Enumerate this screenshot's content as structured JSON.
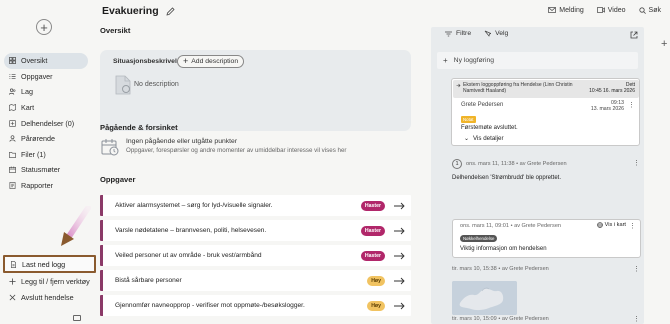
{
  "sidebar": {
    "new_label": "+",
    "items": [
      {
        "label": "Oversikt",
        "icon": "grid-icon"
      },
      {
        "label": "Oppgaver",
        "icon": "checklist-icon"
      },
      {
        "label": "Lag",
        "icon": "people-icon"
      },
      {
        "label": "Kart",
        "icon": "map-icon"
      },
      {
        "label": "Delhendelser (0)",
        "icon": "subevent-icon"
      },
      {
        "label": "Pårørende",
        "icon": "contacts-icon"
      },
      {
        "label": "Filer (1)",
        "icon": "folder-icon"
      },
      {
        "label": "Statusmøter",
        "icon": "calendar-icon"
      },
      {
        "label": "Rapporter",
        "icon": "report-icon"
      }
    ],
    "bottom": {
      "download_log": "Last ned logg",
      "add_remove_tools": "Legg til / fjern verktøy",
      "end_event": "Avslutt hendelse"
    }
  },
  "header": {
    "title": "Evakuering",
    "message": "Melding",
    "video": "Video",
    "search": "Søk"
  },
  "overview": {
    "title": "Oversikt",
    "situation_label": "Situasjonsbeskrivelse",
    "add_description": "Add description",
    "no_description": "No description"
  },
  "pending": {
    "title": "Pågående & forsinket",
    "empty_title": "Ingen pågående eller utgåtte punkter",
    "empty_sub": "Oppgaver, forespørsler og andre momenter av umiddelbar interesse vil vises her"
  },
  "tasks": {
    "title": "Oppgaver",
    "items": [
      {
        "text": "Aktiver alarmsystemet – sørg for lyd-/visuelle signaler.",
        "badge": "Haster",
        "level": "h"
      },
      {
        "text": "Varsle nødetatene – brannvesen, politi, helsevesen.",
        "badge": "Haster",
        "level": "h"
      },
      {
        "text": "Veiled personer ut av område - bruk vest/armbånd",
        "badge": "Haster",
        "level": "h"
      },
      {
        "text": "Bistå sårbare personer",
        "badge": "Høy",
        "level": "y"
      },
      {
        "text": "Gjennomfør navneopprop - verifiser mot oppmøte-/besøkslogger.",
        "badge": "Høy",
        "level": "y"
      }
    ]
  },
  "log": {
    "filter": "Filtre",
    "select": "Velg",
    "new_entry": "Ny loggføring",
    "pinned": {
      "source": "Ekstern loggoppføring fra Hendelse (Linn Christin Namtvedt Haaland)",
      "org": "Dett",
      "org_time": "10:45 16. mars 2026",
      "author": "Grete Pedersen",
      "time": "09:13",
      "date": "13. mars 2026",
      "tag": "Notat",
      "text": "Førstemøte avsluttet.",
      "details": "Vis detaljer"
    },
    "entry1": {
      "num": "1",
      "head": "ons. mars 11, 11:38 • av Grete Pedersen",
      "text": "Delhendelsen 'Strømbrudd' ble opprettet."
    },
    "entry2": {
      "head": "ons. mars 11, 09:01 • av Grete Pedersen",
      "map": "Vis i kart",
      "tag": "Nøkkelhendelse",
      "text": "Viktig informasjon om hendelsen"
    },
    "entry3": {
      "head": "tir. mars 10, 15:38 • av Grete Pedersen"
    },
    "entry4": {
      "head": "tir. mars 10, 15:09 • av Grete Pedersen"
    }
  },
  "colors": {
    "accent_urgent": "#b1276a",
    "accent_high": "#f1c361",
    "annotation": "#8a5a2e"
  }
}
